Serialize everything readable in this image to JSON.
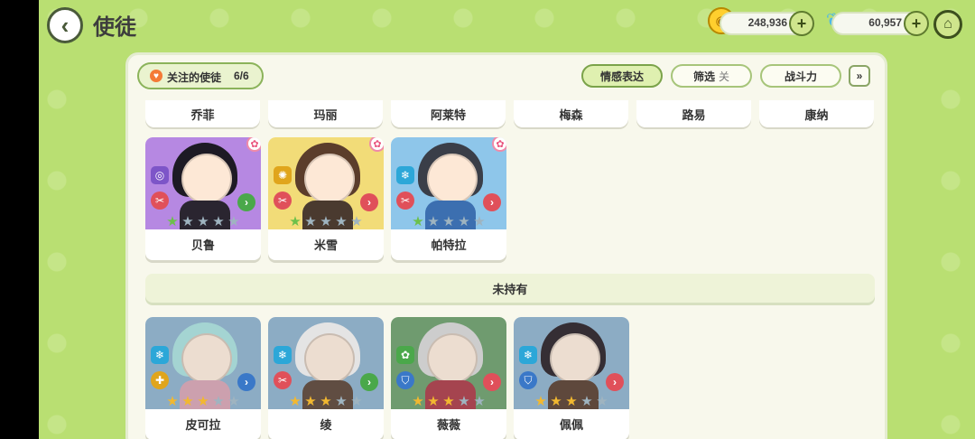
{
  "header": {
    "back_icon": "chevron-left-icon",
    "title": "使徒",
    "coins": "248,936",
    "crystals": "60,957",
    "coin_icon": "coin-icon",
    "crystal_icon": "butterfly-icon",
    "home_icon": "home-icon"
  },
  "toolbar": {
    "follow_label": "关注的使徒",
    "follow_count": "6/6",
    "emotion_label": "情感表达",
    "filter_label": "筛选",
    "filter_state": "关",
    "power_label": "战斗力",
    "expand_icon": "double-chevron-down-icon"
  },
  "top_row_names": [
    "乔菲",
    "玛丽",
    "阿莱特",
    "梅森",
    "路易",
    "康纳"
  ],
  "owned": [
    {
      "name": "贝鲁",
      "stars": 1,
      "element": "vortex",
      "bg": "#b688e2",
      "hair": "#1d1a24",
      "outfit": "#2a2530",
      "elem_color": "#7d55c8",
      "elem_glyph": "◎"
    },
    {
      "name": "米雪",
      "stars": 1,
      "element": "sun",
      "bg": "#f2dc78",
      "hair": "#5b3d2b",
      "outfit": "#4a3a2f",
      "elem_color": "#e0a51c",
      "elem_glyph": "✺"
    },
    {
      "name": "帕特拉",
      "stars": 1,
      "element": "ice",
      "bg": "#8ec6ea",
      "hair": "#3a3e48",
      "outfit": "#3c6fb0",
      "elem_color": "#2ca7d8",
      "elem_glyph": "❄"
    }
  ],
  "section_label": "未持有",
  "unowned": [
    {
      "name": "皮可拉",
      "stars": 3,
      "bg": "#8ab7d8",
      "hair": "#9fe3e0",
      "outfit": "#e3a5b8",
      "elem_color": "#2ca7d8",
      "elem_glyph": "❄",
      "role_color": "#e0a51c",
      "role_glyph": "✚"
    },
    {
      "name": "绫",
      "stars": 3,
      "bg": "#8ab7d8",
      "hair": "#f0f0f0",
      "outfit": "#6a5040",
      "elem_color": "#2ca7d8",
      "elem_glyph": "❄",
      "role_color": "#e0505a",
      "role_glyph": "✂"
    },
    {
      "name": "薇薇",
      "stars": 3,
      "bg": "#6aa86a",
      "hair": "#d8d8d8",
      "outfit": "#c84050",
      "elem_color": "#4aa84a",
      "elem_glyph": "✿",
      "role_color": "#3a78c8",
      "role_glyph": "⛉"
    },
    {
      "name": "佩佩",
      "stars": 3,
      "bg": "#8ab7d8",
      "hair": "#3a3038",
      "outfit": "#6a4a3a",
      "elem_color": "#2ca7d8",
      "elem_glyph": "❄",
      "role_color": "#3a78c8",
      "role_glyph": "⛉"
    }
  ],
  "colors": {
    "background": "#b9df72",
    "panel": "#f8f8ec",
    "accent": "#7ba34a",
    "star_on": "#6cc04a",
    "star_gold": "#f2b830",
    "star_off": "#9fb4c0"
  }
}
